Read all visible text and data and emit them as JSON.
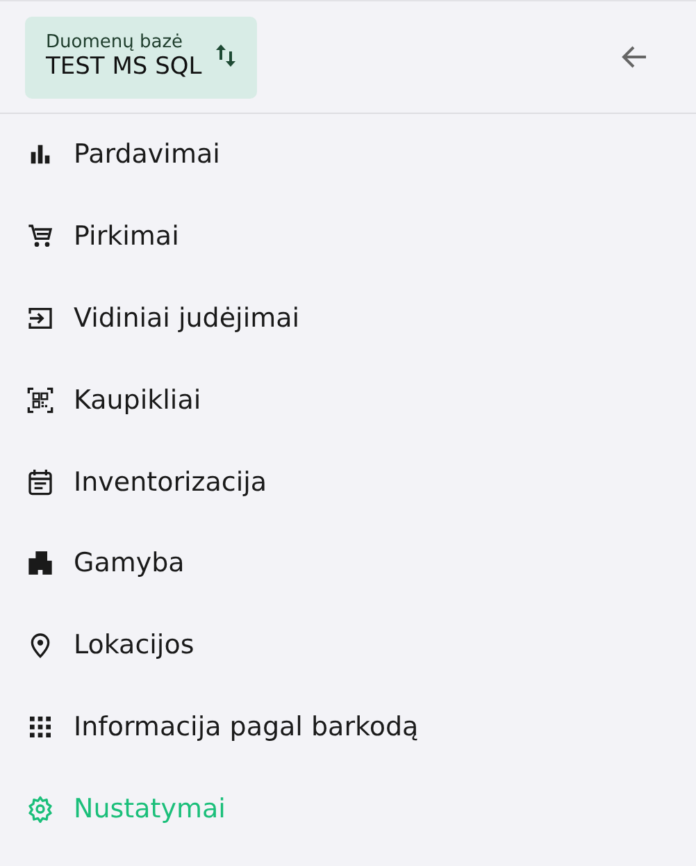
{
  "database": {
    "label": "Duomenų bazė",
    "value": "TEST MS SQL"
  },
  "menu": [
    {
      "kind": "chart",
      "label": "Pardavimai",
      "selected": false
    },
    {
      "kind": "cart",
      "label": "Pirkimai",
      "selected": false
    },
    {
      "kind": "enter",
      "label": "Vidiniai judėjimai",
      "selected": false
    },
    {
      "kind": "qr",
      "label": "Kaupikliai",
      "selected": false
    },
    {
      "kind": "calendar",
      "label": "Inventorizacija",
      "selected": false
    },
    {
      "kind": "building",
      "label": "Gamyba",
      "selected": false
    },
    {
      "kind": "pin",
      "label": "Lokacijos",
      "selected": false
    },
    {
      "kind": "grid",
      "label": "Informacija pagal barkodą",
      "selected": false
    },
    {
      "kind": "gear",
      "label": "Nustatymai",
      "selected": true
    }
  ]
}
